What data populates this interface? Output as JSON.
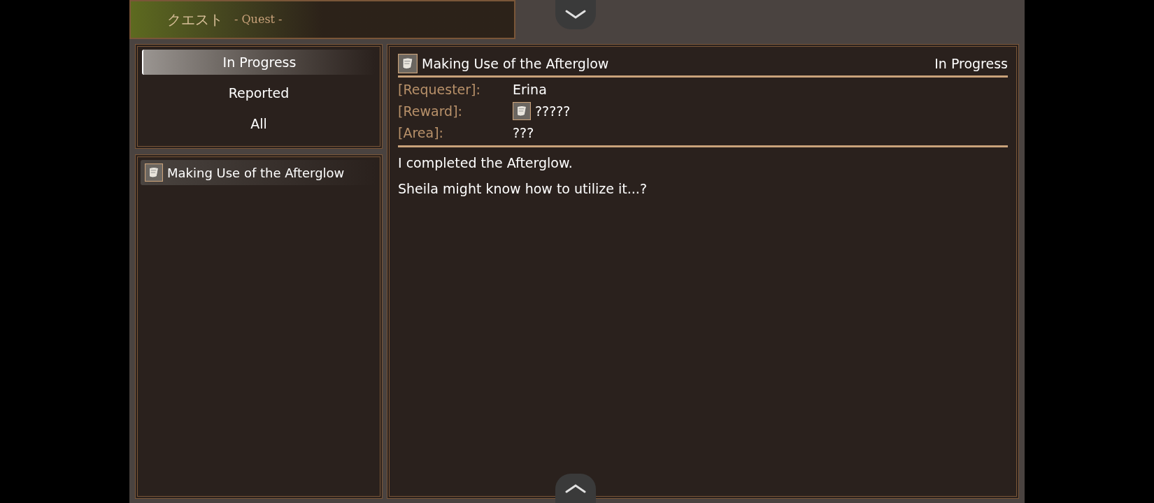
{
  "header": {
    "title": "クエスト",
    "subtitle": "- Quest -"
  },
  "filters": [
    {
      "label": "In Progress",
      "selected": true
    },
    {
      "label": "Reported",
      "selected": false
    },
    {
      "label": "All",
      "selected": false
    }
  ],
  "quests": [
    {
      "title": "Making Use of the Afterglow",
      "selected": true
    }
  ],
  "detail": {
    "title": "Making Use of the Afterglow",
    "status": "In Progress",
    "fields": [
      {
        "label": "[Requester]:",
        "value": "Erina",
        "icon": false
      },
      {
        "label": "[Reward]:",
        "value": "?????",
        "icon": true
      },
      {
        "label": "[Area]:",
        "value": "???",
        "icon": false
      }
    ],
    "description": [
      "I completed the Afterglow.",
      "Sheila might know how to utilize it...?"
    ]
  }
}
